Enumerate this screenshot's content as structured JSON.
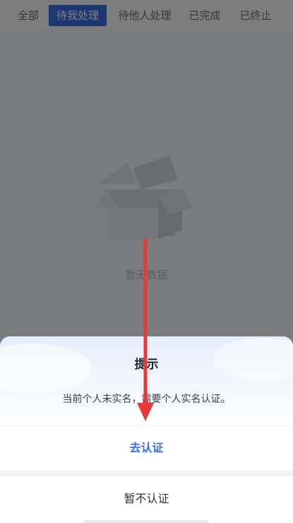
{
  "tabs": [
    {
      "label": "全部",
      "active": false
    },
    {
      "label": "待我处理",
      "active": true
    },
    {
      "label": "待他人处理",
      "active": false
    },
    {
      "label": "已完成",
      "active": false
    },
    {
      "label": "已终止",
      "active": false
    }
  ],
  "empty_state": {
    "icon": "empty-box-icon",
    "text": "暂无数据"
  },
  "dialog": {
    "title": "提示",
    "message": "当前个人未实名，需要个人实名认证。",
    "confirm_label": "去认证",
    "cancel_label": "暂不认证"
  },
  "annotation": {
    "icon": "red-arrow-down-icon",
    "color": "#e8393a"
  },
  "colors": {
    "accent": "#3a6fea",
    "overlay": "rgba(0,0,0,0.5)"
  }
}
